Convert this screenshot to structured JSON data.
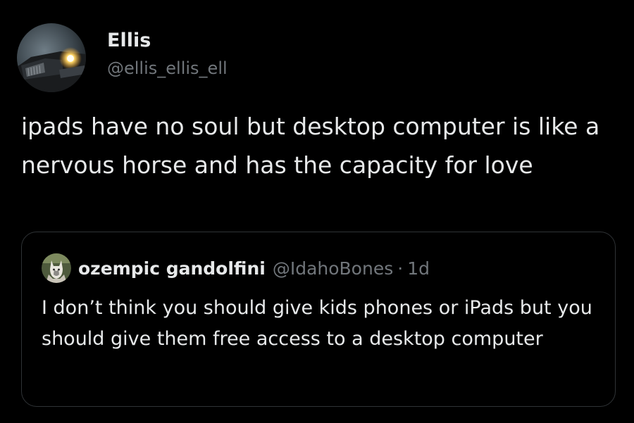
{
  "post": {
    "author": {
      "display_name": "Ellis",
      "handle": "@ellis_ellis_ell"
    },
    "text": "ipads have no soul but desktop computer is like a nervous horse and has the capacity for love"
  },
  "quoted_post": {
    "author": {
      "display_name": "ozempic gandolfini",
      "handle": "@IdahoBones"
    },
    "separator": "·",
    "time": "1d",
    "text": "I don’t think you should give kids phones or iPads but you should give them free access to a desktop computer"
  },
  "colors": {
    "background": "#000000",
    "primary_text": "#e7e9ea",
    "secondary_text": "#71767b",
    "border": "#2f3336"
  },
  "icons": {
    "author_avatar": "car-headlight-photo-avatar",
    "quoted_author_avatar": "cat-photo-avatar"
  }
}
